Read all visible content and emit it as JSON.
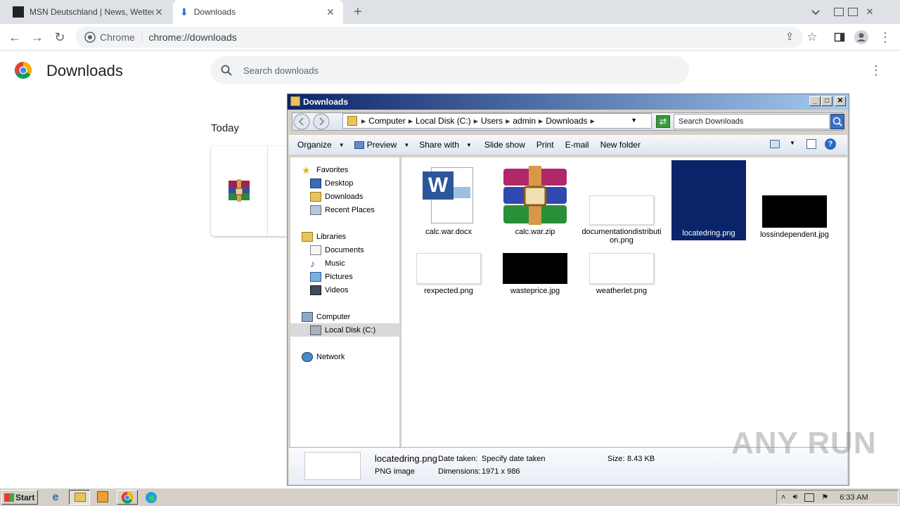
{
  "browser": {
    "tabs": [
      {
        "title": "MSN Deutschland | News, Wetter, Sta",
        "active": false
      },
      {
        "title": "Downloads",
        "active": true
      }
    ],
    "omnibox": {
      "site": "Chrome",
      "url_scheme": "chrome://",
      "url_path": "downloads"
    }
  },
  "downloads_page": {
    "title": "Downloads",
    "search_placeholder": "Search downloads",
    "section_today": "Today"
  },
  "explorer": {
    "window_title": "Downloads",
    "breadcrumb": [
      "Computer",
      "Local Disk (C:)",
      "Users",
      "admin",
      "Downloads"
    ],
    "search_placeholder": "Search Downloads",
    "commands": [
      {
        "label": "Organize",
        "dropdown": true
      },
      {
        "label": "Preview",
        "dropdown": true
      },
      {
        "label": "Share with",
        "dropdown": true
      },
      {
        "label": "Slide show",
        "dropdown": false
      },
      {
        "label": "Print",
        "dropdown": false
      },
      {
        "label": "E-mail",
        "dropdown": false
      },
      {
        "label": "New folder",
        "dropdown": false
      }
    ],
    "nav": {
      "favorites": "Favorites",
      "desktop": "Desktop",
      "downloads": "Downloads",
      "recent_places": "Recent Places",
      "libraries": "Libraries",
      "documents": "Documents",
      "music": "Music",
      "pictures": "Pictures",
      "videos": "Videos",
      "computer": "Computer",
      "local_disk": "Local Disk (C:)",
      "network": "Network"
    },
    "files": [
      {
        "name": "calc.war.docx",
        "kind": "word-doc"
      },
      {
        "name": "calc.war.zip",
        "kind": "winrar-archive"
      },
      {
        "name": "documentationdistribution.png",
        "kind": "white-image"
      },
      {
        "name": "locatedring.png",
        "kind": "white-image",
        "selected": true
      },
      {
        "name": "lossindependent.jpg",
        "kind": "black-image"
      },
      {
        "name": "rexpected.png",
        "kind": "white-image"
      },
      {
        "name": "wasteprice.jpg",
        "kind": "black-image"
      },
      {
        "name": "weatherlet.png",
        "kind": "white-image"
      }
    ],
    "details": {
      "filename": "locatedring.png",
      "type": "PNG image",
      "date_taken_label": "Date taken:",
      "date_taken_value": "Specify date taken",
      "dimensions_label": "Dimensions:",
      "dimensions_value": "1971 x 986",
      "size_label": "Size:",
      "size_value": "8.43 KB"
    }
  },
  "taskbar": {
    "start_label": "Start",
    "clock": "6:33 AM"
  },
  "watermark": "ANY RUN",
  "colors": {
    "selection_blue": "#0a246a",
    "chrome_tabstrip": "#dee1e6",
    "win_classic": "#d4d0c8"
  }
}
